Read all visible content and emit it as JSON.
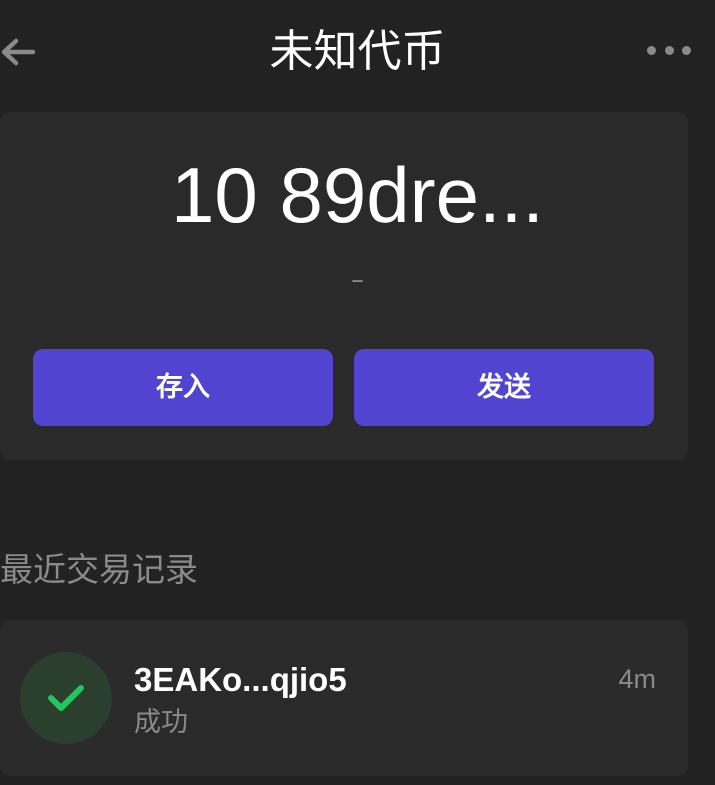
{
  "header": {
    "title": "未知代币",
    "back_icon": "arrow-left-icon",
    "more_icon": "more-horizontal-icon"
  },
  "balance": {
    "amount": "10 89dre...",
    "fiat_value": "–"
  },
  "actions": {
    "deposit_label": "存入",
    "send_label": "发送"
  },
  "recent": {
    "section_title": "最近交易记录",
    "transactions": [
      {
        "address": "3EAKo...qjio5",
        "status": "成功",
        "time": "4m",
        "status_icon": "check-icon"
      }
    ]
  },
  "colors": {
    "background": "#222222",
    "card": "#2a2a2a",
    "accent": "#5044d0",
    "success": "#22c55e",
    "muted_text": "#8a8a8a"
  }
}
